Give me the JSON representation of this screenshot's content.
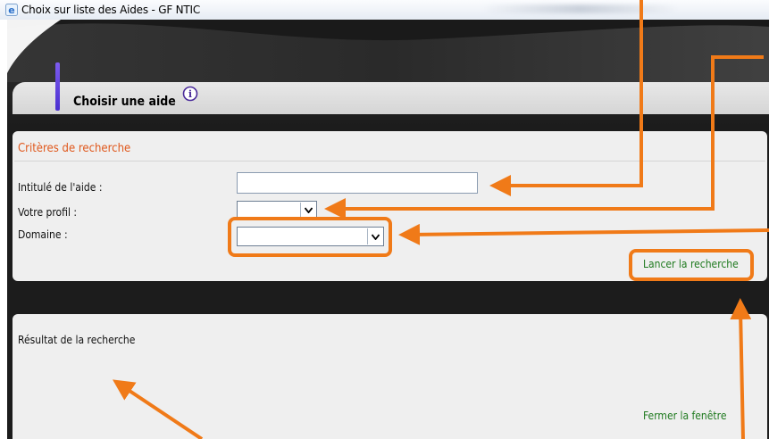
{
  "window": {
    "title": "Choix sur liste des Aides - GF NTIC"
  },
  "header": {
    "title": "Choisir une aide"
  },
  "criteria": {
    "section_title": "Critères de recherche",
    "fields": {
      "intitule_label": "Intitulé de l'aide :",
      "intitule_value": "",
      "profil_label": "Votre profil :",
      "profil_value": "",
      "domaine_label": "Domaine :",
      "domaine_value": ""
    },
    "search_button": "Lancer la recherche"
  },
  "results": {
    "title": "Résultat de la recherche",
    "close_button": "Fermer la fenêtre"
  },
  "colors": {
    "annotation": "#f07a18",
    "section_title": "#e0581c",
    "link": "#1f7a1f",
    "header_bar": "#6a4ee8"
  },
  "icons": {
    "window": "ie-icon",
    "info": "info-icon",
    "dropdown": "chevron-down-icon"
  }
}
